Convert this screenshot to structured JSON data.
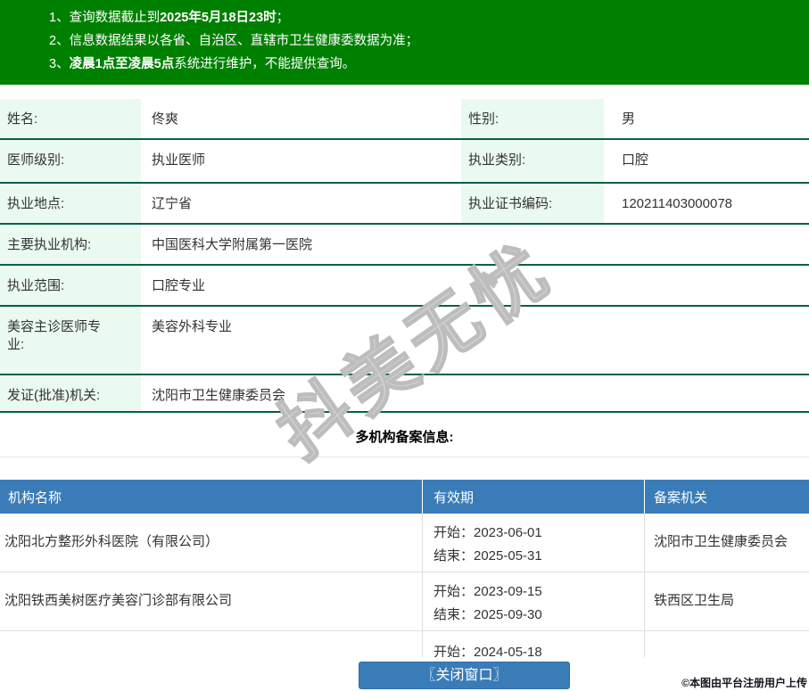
{
  "banner": {
    "bg": "#008000",
    "lines": [
      {
        "num": "1、",
        "pre": "查询数据截止到",
        "strong": "2025年5月18日23时",
        "post": "；"
      },
      {
        "num": "2、",
        "pre": "信息数据结果以各省、自治区、直辖市卫生健康委数据为准；",
        "strong": "",
        "post": ""
      },
      {
        "num": "3、",
        "pre": "",
        "strong": "凌晨1点至凌晨5点",
        "post": "系统进行维护，不能提供查询。"
      }
    ]
  },
  "info": {
    "rows": [
      {
        "label": "姓名:",
        "value": "佟爽",
        "label2": "性别:",
        "value2": "男"
      },
      {
        "label": "医师级别:",
        "value": "执业医师",
        "label2": "执业类别:",
        "value2": "口腔"
      },
      {
        "label": "执业地点:",
        "value": "辽宁省",
        "label2": "执业证书编码:",
        "value2": "120211403000078"
      },
      {
        "label": "主要执业机构:",
        "value": "中国医科大学附属第一医院"
      },
      {
        "label": "执业范围:",
        "value": "口腔专业"
      },
      {
        "label": "美容主诊医师专业:",
        "value": "美容外科专业"
      },
      {
        "label": "发证(批准)机关:",
        "value": "沈阳市卫生健康委员会"
      }
    ]
  },
  "section_title": "多机构备案信息:",
  "org_table": {
    "headers": [
      "机构名称",
      "有效期",
      "备案机关"
    ],
    "rows": [
      {
        "name": "沈阳北方整形外科医院（有限公司）",
        "start": "开始：2023-06-01",
        "end": "结束：2025-05-31",
        "authority": "沈阳市卫生健康委员会"
      },
      {
        "name": "沈阳铁西美树医疗美容门诊部有限公司",
        "start": "开始：2023-09-15",
        "end": "结束：2025-09-30",
        "authority": "铁西区卫生局"
      },
      {
        "name": "",
        "start": "开始：2024-05-18",
        "end": "",
        "authority": ""
      }
    ]
  },
  "close_button_label": "〖关闭窗口〗",
  "watermark_text": "抖美无忧",
  "footer_note": "©本图由平台注册用户上传",
  "colors": {
    "banner_green": "#008000",
    "label_bg": "#eafaf1",
    "row_border": "#05604a",
    "table_blue": "#3a7cb8",
    "light_border": "#dddddd"
  }
}
